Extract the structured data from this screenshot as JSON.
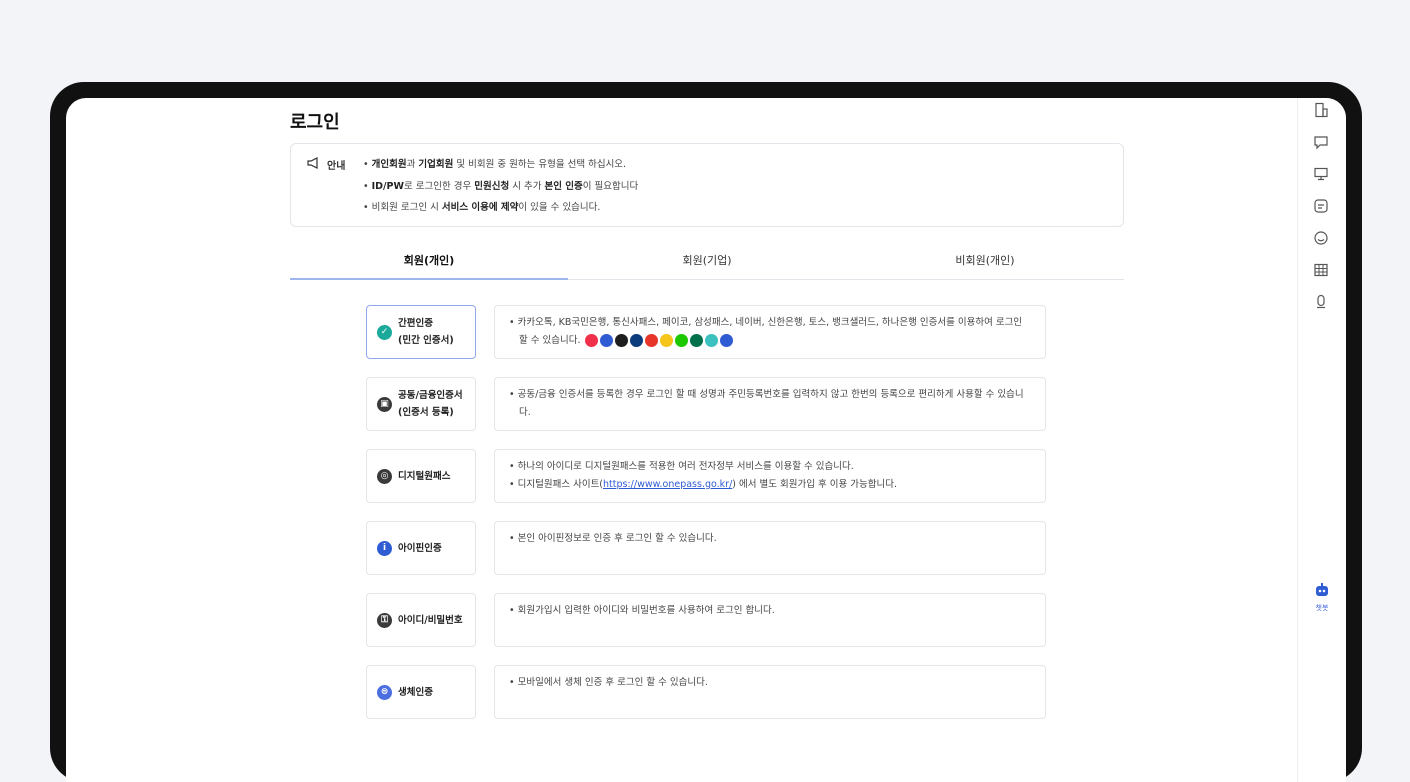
{
  "page": {
    "title": "로그인"
  },
  "notice": {
    "label": "안내",
    "line1": {
      "b1": "개인회원",
      "t1": "과 ",
      "b2": "기업회원",
      "t2": " 및 비회원 중 원하는 유형을 선택 하십시오."
    },
    "line2": {
      "b1": "ID/PW",
      "t1": "로 로그인한 경우 ",
      "b2": "민원신청",
      "t2": " 시 추가 ",
      "b3": "본인 인증",
      "t3": "이 필요합니다"
    },
    "line3": {
      "t1": "비회원 로그인 시 ",
      "b1": "서비스 이용에 제약",
      "t2": "이 있을 수 있습니다."
    }
  },
  "tabs": [
    {
      "label": "회원(개인)",
      "active": true
    },
    {
      "label": "회원(기업)",
      "active": false
    },
    {
      "label": "비회원(개인)",
      "active": false
    }
  ],
  "methods": [
    {
      "label1": "간편인증",
      "label2": "(민간 인증서)",
      "icon": "check-shield-icon",
      "icon_color": "#1aa99a",
      "selected": true,
      "desc": [
        "카카오톡, KB국민은행, 통신사패스, 페이코, 삼성패스, 네이버, 신한은행, 토스, 뱅크샐러드, 하나은행 인증서를 이용하여 로그인 할 수 있습니다."
      ]
    },
    {
      "label1": "공동/금융인증서",
      "label2": "(인증서 등록)",
      "icon": "certificate-icon",
      "icon_color": "#3a3a3a",
      "selected": false,
      "desc": [
        "공동/금융 인증서를 등록한 경우 로그인 할 때 성명과 주민등록번호를 입력하지 않고 한번의 등록으로 편리하게 사용할 수 있습니다."
      ]
    },
    {
      "label1": "디지털원패스",
      "label2": "",
      "icon": "fingerprint-icon",
      "icon_color": "#3a3a3a",
      "selected": false,
      "desc": [
        "하나의 아이디로 디지털원패스를 적용한 여러 전자정부 서비스를 이용할 수 있습니다."
      ],
      "desc2": {
        "t1": "디지털원패스 사이트(",
        "link": "https://www.onepass.go.kr/",
        "t2": ") 에서 별도 회원가입 후 이용 가능합니다."
      }
    },
    {
      "label1": "아이핀인증",
      "label2": "",
      "icon": "info-icon",
      "icon_color": "#2f5bd3",
      "selected": false,
      "desc": [
        "본인 아이핀정보로 인증 후 로그인 할 수 있습니다."
      ]
    },
    {
      "label1": "아이디/비밀번호",
      "label2": "",
      "icon": "lock-icon",
      "icon_color": "#3a3a3a",
      "selected": false,
      "desc": [
        "회원가입시 입력한 아이디와 비밀번호를 사용하여 로그인 합니다."
      ]
    },
    {
      "label1": "생체인증",
      "label2": "",
      "icon": "biometric-icon",
      "icon_color": "#4b6ee0",
      "selected": false,
      "desc": [
        "모바일에서 생체 인증 후 로그인 할 수 있습니다."
      ]
    }
  ],
  "brand_colors": [
    "#f0304a",
    "#2f5bd3",
    "#1e1e1e",
    "#0c3c7c",
    "#e8352a",
    "#f5c51a",
    "#1ec800",
    "#00704a",
    "#3cc0c0",
    "#2f5bd3"
  ],
  "rail": {
    "icons": [
      "document-icon",
      "chat-icon",
      "monitor-icon",
      "message-icon",
      "smile-icon",
      "grid-icon",
      "mic-icon"
    ],
    "chatbot_label": "챗봇"
  }
}
